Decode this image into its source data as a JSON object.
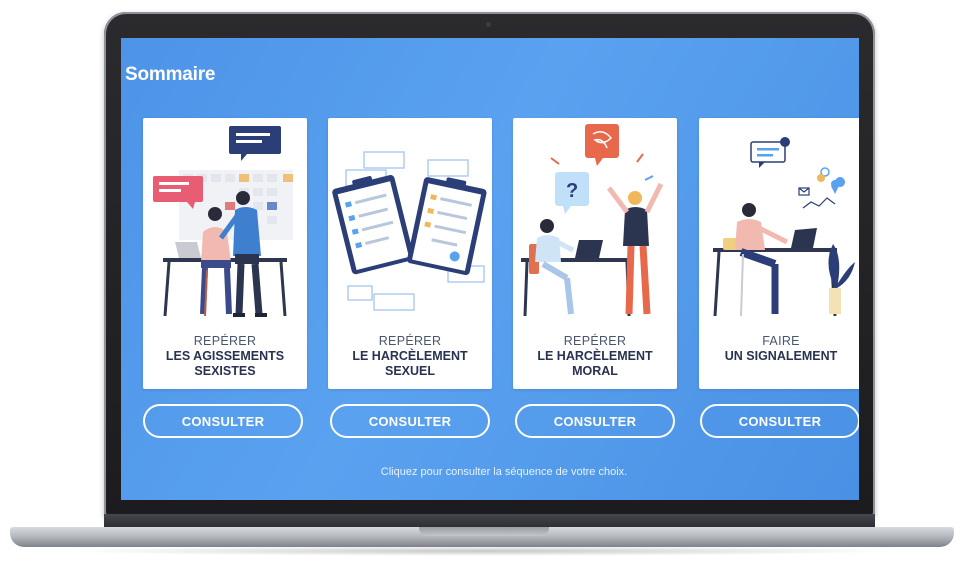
{
  "screen": {
    "title": "Sommaire",
    "hint": "Cliquez pour consulter la séquence de votre choix."
  },
  "cards": [
    {
      "verb": "REPÉRER",
      "line1": "LES AGISSEMENTS",
      "line2": "SEXISTES",
      "button": "CONSULTER",
      "illustration": "office-coworkers-illustration"
    },
    {
      "verb": "REPÉRER",
      "line1": "LE HARCÈLEMENT",
      "line2": "SEXUEL",
      "button": "CONSULTER",
      "illustration": "documents-clipboards-illustration"
    },
    {
      "verb": "REPÉRER",
      "line1": "LE HARCÈLEMENT",
      "line2": "MORAL",
      "button": "CONSULTER",
      "illustration": "angry-coworker-illustration"
    },
    {
      "verb": "FAIRE",
      "line1": "UN SIGNALEMENT",
      "line2": "",
      "button": "CONSULTER",
      "illustration": "reporting-desk-illustration"
    }
  ],
  "colors": {
    "screen_blue": "#5aa2f0",
    "card_text": "#283352",
    "button_border": "#ffffff"
  }
}
